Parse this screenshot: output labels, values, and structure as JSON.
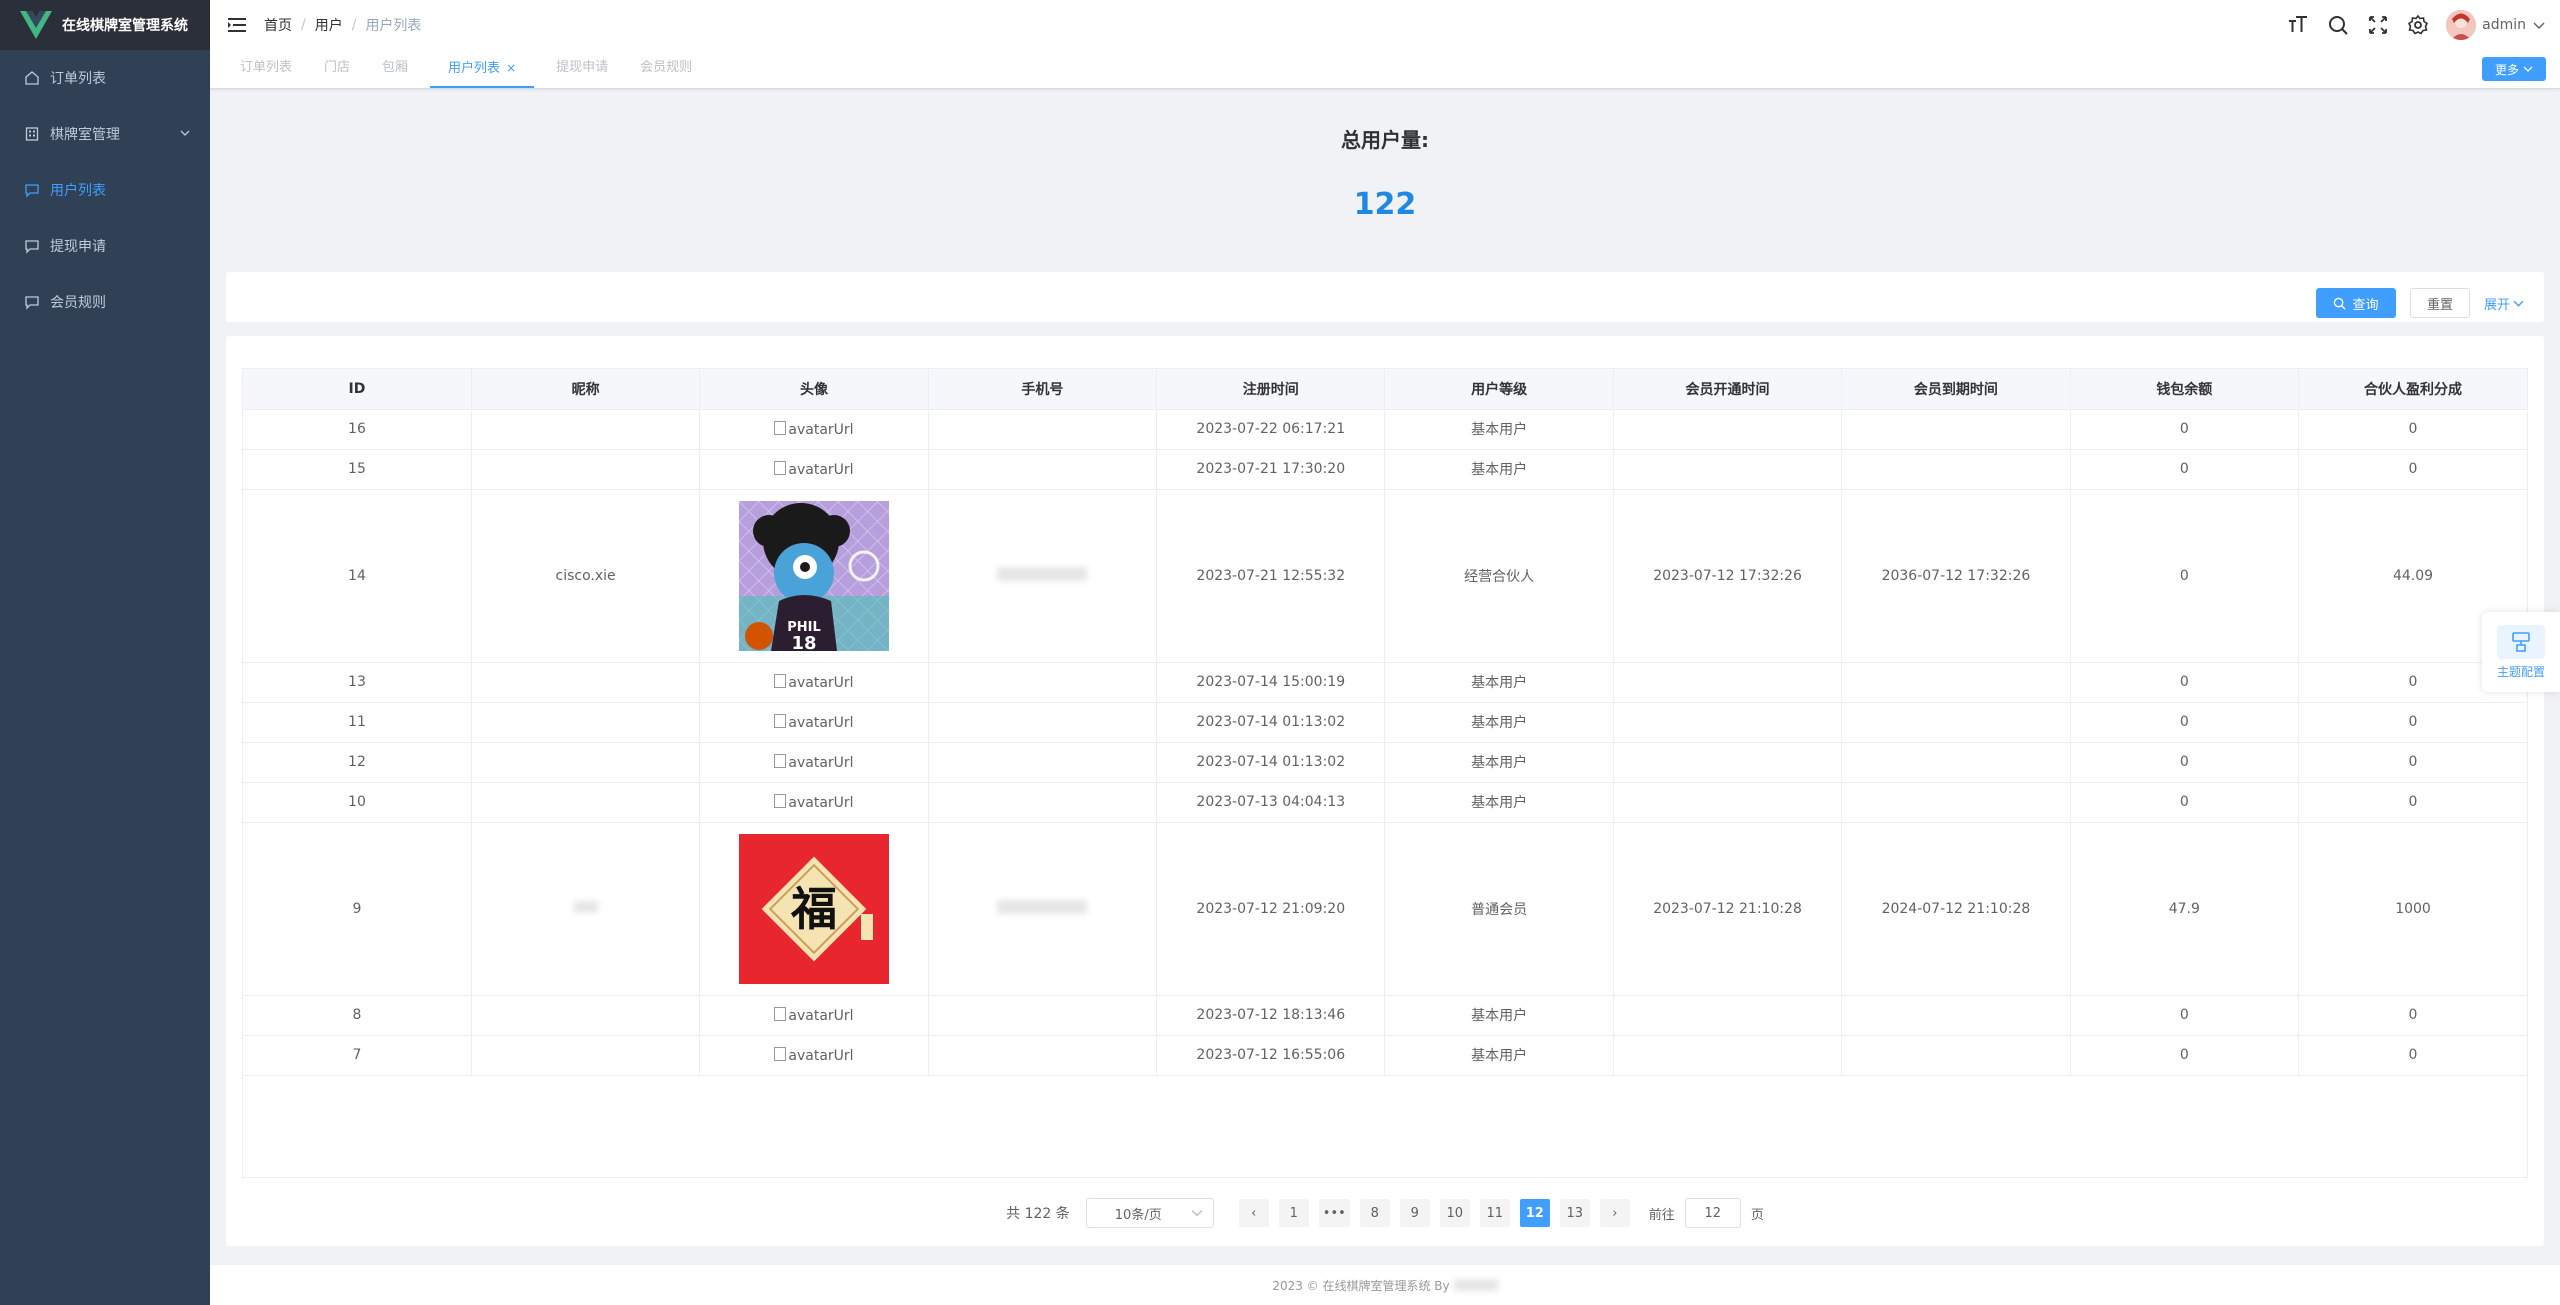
{
  "app": {
    "title": "在线棋牌室管理系统"
  },
  "sidebar": {
    "items": [
      {
        "label": "订单列表",
        "icon": "home-icon"
      },
      {
        "label": "棋牌室管理",
        "icon": "building-icon"
      },
      {
        "label": "用户列表",
        "icon": "chat-icon",
        "active": true
      },
      {
        "label": "提现申请",
        "icon": "chat-icon"
      },
      {
        "label": "会员规则",
        "icon": "chat-icon"
      }
    ]
  },
  "header": {
    "breadcrumb": [
      "首页",
      "用户",
      "用户列表"
    ],
    "username": "admin"
  },
  "tags": {
    "items": [
      "订单列表",
      "门店",
      "包厢",
      "用户列表",
      "提现申请",
      "会员规则"
    ],
    "active": "用户列表",
    "close_glyph": "×",
    "more_label": "更多"
  },
  "stats": {
    "label": "总用户量:",
    "value": "122"
  },
  "search": {
    "query_label": "查询",
    "reset_label": "重置",
    "expand_label": "展开"
  },
  "table": {
    "columns": [
      "ID",
      "昵称",
      "头像",
      "手机号",
      "注册时间",
      "用户等级",
      "会员开通时间",
      "会员到期时间",
      "钱包余额",
      "合伙人盈利分成"
    ],
    "rows": [
      {
        "id": "16",
        "nickname": "",
        "avatar": "avatarUrl",
        "phone": "",
        "reg_time": "2023-07-22 06:17:21",
        "level": "基本用户",
        "vip_start": "",
        "vip_end": "",
        "wallet": "0",
        "share": "0"
      },
      {
        "id": "15",
        "nickname": "",
        "avatar": "avatarUrl",
        "phone": "",
        "reg_time": "2023-07-21 17:30:20",
        "level": "基本用户",
        "vip_start": "",
        "vip_end": "",
        "wallet": "0",
        "share": "0"
      },
      {
        "id": "14",
        "nickname": "cisco.xie",
        "avatar": "",
        "phone": "",
        "reg_time": "2023-07-21 12:55:32",
        "level": "经营合伙人",
        "vip_start": "2023-07-12 17:32:26",
        "vip_end": "2036-07-12 17:32:26",
        "wallet": "0",
        "share": "44.09"
      },
      {
        "id": "13",
        "nickname": "",
        "avatar": "avatarUrl",
        "phone": "",
        "reg_time": "2023-07-14 15:00:19",
        "level": "基本用户",
        "vip_start": "",
        "vip_end": "",
        "wallet": "0",
        "share": "0"
      },
      {
        "id": "11",
        "nickname": "",
        "avatar": "avatarUrl",
        "phone": "",
        "reg_time": "2023-07-14 01:13:02",
        "level": "基本用户",
        "vip_start": "",
        "vip_end": "",
        "wallet": "0",
        "share": "0"
      },
      {
        "id": "12",
        "nickname": "",
        "avatar": "avatarUrl",
        "phone": "",
        "reg_time": "2023-07-14 01:13:02",
        "level": "基本用户",
        "vip_start": "",
        "vip_end": "",
        "wallet": "0",
        "share": "0"
      },
      {
        "id": "10",
        "nickname": "",
        "avatar": "avatarUrl",
        "phone": "",
        "reg_time": "2023-07-13 04:04:13",
        "level": "基本用户",
        "vip_start": "",
        "vip_end": "",
        "wallet": "0",
        "share": "0"
      },
      {
        "id": "9",
        "nickname": "",
        "avatar": "",
        "phone": "",
        "reg_time": "2023-07-12 21:09:20",
        "level": "普通会员",
        "vip_start": "2023-07-12 21:10:28",
        "vip_end": "2024-07-12 21:10:28",
        "wallet": "47.9",
        "share": "1000"
      },
      {
        "id": "8",
        "nickname": "",
        "avatar": "avatarUrl",
        "phone": "",
        "reg_time": "2023-07-12 18:13:46",
        "level": "基本用户",
        "vip_start": "",
        "vip_end": "",
        "wallet": "0",
        "share": "0"
      },
      {
        "id": "7",
        "nickname": "",
        "avatar": "avatarUrl",
        "phone": "",
        "reg_time": "2023-07-12 16:55:06",
        "level": "基本用户",
        "vip_start": "",
        "vip_end": "",
        "wallet": "0",
        "share": "0"
      }
    ],
    "fu_char": "福"
  },
  "pagination": {
    "total_text": "共 122 条",
    "page_size": "10条/页",
    "prev_glyph": "‹",
    "next_glyph": "›",
    "ellipsis": "•••",
    "pages": [
      "1",
      "8",
      "9",
      "10",
      "11",
      "12",
      "13"
    ],
    "current": "12",
    "goto_label": "前往",
    "goto_value": "12",
    "page_unit": "页"
  },
  "footer": {
    "text": "2023 © 在线棋牌室管理系统 By"
  },
  "theme_config": {
    "label": "主题配置"
  },
  "colors": {
    "primary": "#409eff",
    "sidebar_bg": "#304156",
    "logo_bg": "#2b2f3a",
    "stat_value": "#1e88e5"
  }
}
